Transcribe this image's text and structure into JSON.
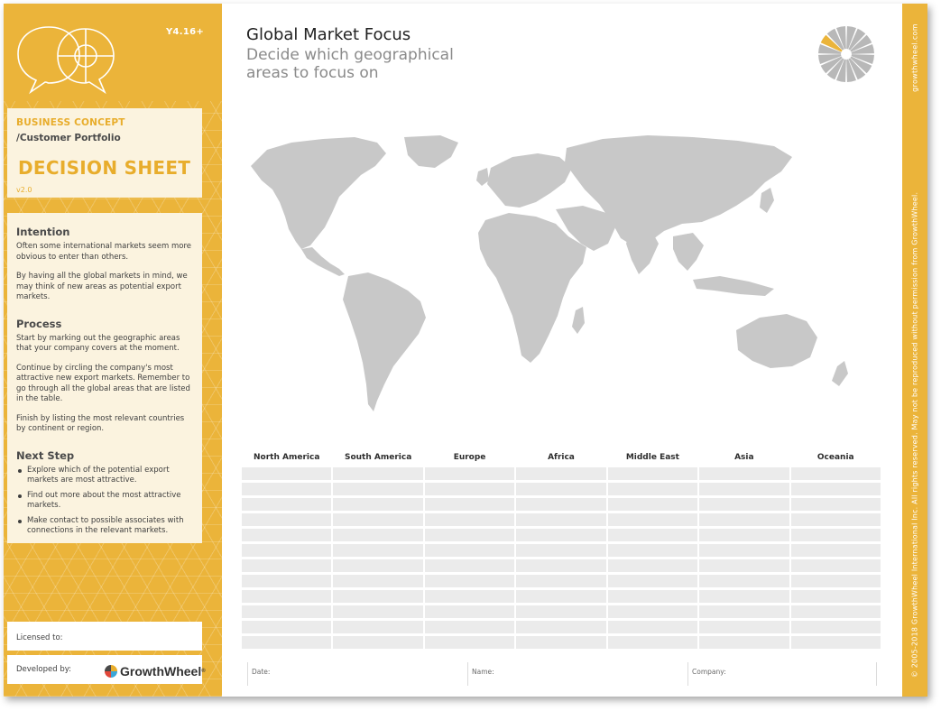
{
  "sidebar": {
    "version_tag": "Y4.16+",
    "concept": {
      "category": "BUSINESS CONCEPT",
      "subcategory": "/Customer Portfolio",
      "title": "DECISION SHEET",
      "version": "v2.0"
    },
    "intention": {
      "heading": "Intention",
      "paragraphs": [
        "Often some international markets seem more obvious to enter than others.",
        "By having all the global markets in mind, we may think of new areas as potential export markets."
      ]
    },
    "process": {
      "heading": "Process",
      "paragraphs": [
        "Start by marking out the geographic areas that your company covers at the moment.",
        "Continue by circling the company's most attractive new export markets. Remember to go through all the global areas that are listed in the table.",
        "Finish by listing the most relevant countries by continent or region."
      ]
    },
    "next_step": {
      "heading": "Next Step",
      "items": [
        "Explore which of the potential export markets are most attractive.",
        "Find out more about the most attractive markets.",
        "Make contact to possible associates with connections in the relevant markets."
      ]
    },
    "licensed_label": "Licensed to:",
    "developed_label": "Developed by:",
    "brand_name": "GrowthWheel",
    "brand_reg": "®"
  },
  "header": {
    "title": "Global Market Focus",
    "subtitle": "Decide which geographical areas to focus on"
  },
  "table": {
    "columns": [
      "North America",
      "South America",
      "Europe",
      "Africa",
      "Middle East",
      "Asia",
      "Oceania"
    ],
    "row_count": 12
  },
  "footer": {
    "date_label": "Date:",
    "name_label": "Name:",
    "company_label": "Company:"
  },
  "strip": {
    "site": "growthwheel.com",
    "copyright": "© 2005-2018 GrowthWheel International Inc. All rights reserved. May not be reproduced without permission from GrowthWheel."
  },
  "colors": {
    "accent": "#ebb43a",
    "panel": "#fbf3df",
    "map": "#c8c8c8",
    "cell": "#ebebeb"
  }
}
